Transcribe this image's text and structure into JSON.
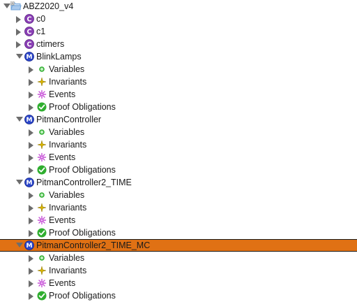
{
  "tree": {
    "project": {
      "label": "ABZ2020_v4",
      "icon": "folder-icon",
      "expanded": true
    },
    "contexts": [
      {
        "label": "c0",
        "icon": "context-icon",
        "badge": "C"
      },
      {
        "label": "c1",
        "icon": "context-icon",
        "badge": "C"
      },
      {
        "label": "ctimers",
        "icon": "context-icon",
        "badge": "C"
      }
    ],
    "machines": [
      {
        "label": "BlinkLamps",
        "badge": "M",
        "expanded": true,
        "selected": false,
        "children": [
          "Variables",
          "Invariants",
          "Events",
          "Proof Obligations"
        ]
      },
      {
        "label": "PitmanController",
        "badge": "M",
        "expanded": true,
        "selected": false,
        "children": [
          "Variables",
          "Invariants",
          "Events",
          "Proof Obligations"
        ]
      },
      {
        "label": "PitmanController2_TIME",
        "badge": "M",
        "expanded": true,
        "selected": false,
        "children": [
          "Variables",
          "Invariants",
          "Events",
          "Proof Obligations"
        ]
      },
      {
        "label": "PitmanController2_TIME_MC",
        "badge": "M",
        "expanded": true,
        "selected": true,
        "children": [
          "Variables",
          "Invariants",
          "Events",
          "Proof Obligations"
        ]
      }
    ],
    "child_icons": [
      "variables-icon",
      "invariants-icon",
      "events-icon",
      "proof-obligations-icon"
    ]
  },
  "colors": {
    "selection": "#e07114",
    "context_badge": "#8a3fb5",
    "machine_badge": "#2a45c9",
    "variables_icon": "#2fae2f",
    "invariants_icon": "#d8b400",
    "events_icon": "#c54fd6",
    "proof_obligations_icon": "#2fae2f",
    "folder": "#6fa3d8"
  }
}
